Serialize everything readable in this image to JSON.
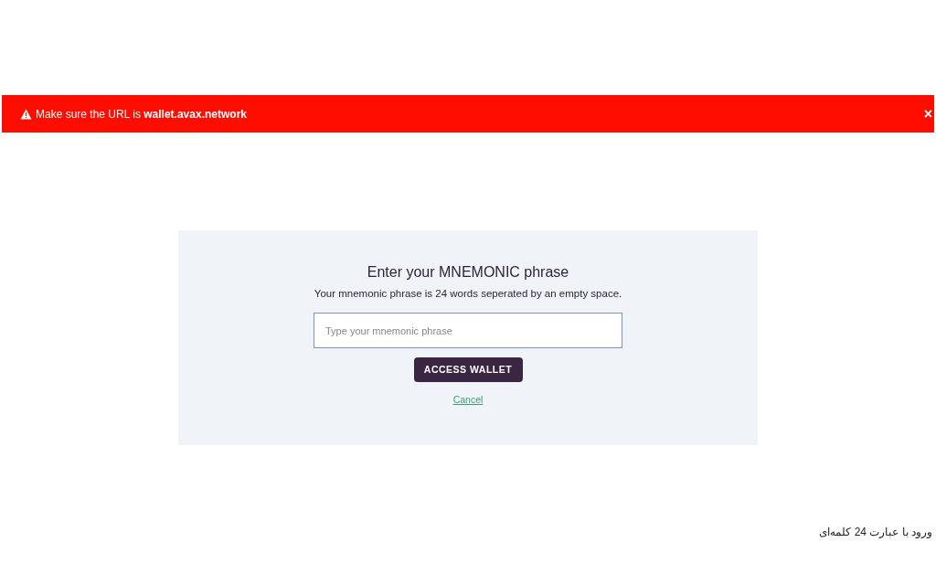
{
  "banner": {
    "message": "Make sure the URL is **wallet.avax.network**",
    "close": "×"
  },
  "form": {
    "title": "Enter your MNEMONIC phrase",
    "subtitle": "Your mnemonic phrase is 24 words seperated by an empty space.",
    "input": {
      "placeholder": "Type your mnemonic phrase"
    },
    "submit": "ACCESS WALLET",
    "cancel": "Cancel"
  },
  "caption": "ورود با عبارت 24 کلمه‌ای"
}
